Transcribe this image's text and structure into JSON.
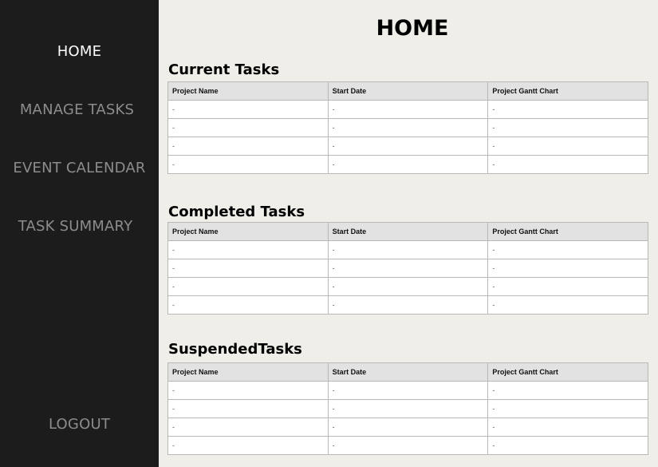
{
  "sidebar": {
    "items": [
      {
        "label": "HOME"
      },
      {
        "label": "MANAGE TASKS"
      },
      {
        "label": "EVENT CALENDAR"
      },
      {
        "label": "TASK SUMMARY"
      }
    ],
    "logout_label": "LOGOUT"
  },
  "page": {
    "title": "HOME"
  },
  "columns": [
    "Project Name",
    "Start Date",
    "Project Gantt Chart"
  ],
  "sections": [
    {
      "title": "Current Tasks",
      "rows": [
        [
          "-",
          "-",
          "-"
        ],
        [
          "-",
          "-",
          "-"
        ],
        [
          "-",
          "-",
          "-"
        ],
        [
          "-",
          "-",
          "-"
        ]
      ]
    },
    {
      "title": "Completed Tasks",
      "rows": [
        [
          "-",
          "-",
          "-"
        ],
        [
          "-",
          "-",
          "-"
        ],
        [
          "-",
          "-",
          "-"
        ],
        [
          "-",
          "-",
          "-"
        ]
      ]
    },
    {
      "title": "SuspendedTasks",
      "rows": [
        [
          "-",
          "-",
          "-"
        ],
        [
          "-",
          "-",
          "-"
        ],
        [
          "-",
          "-",
          "-"
        ],
        [
          "-",
          "-",
          "-"
        ]
      ]
    }
  ]
}
